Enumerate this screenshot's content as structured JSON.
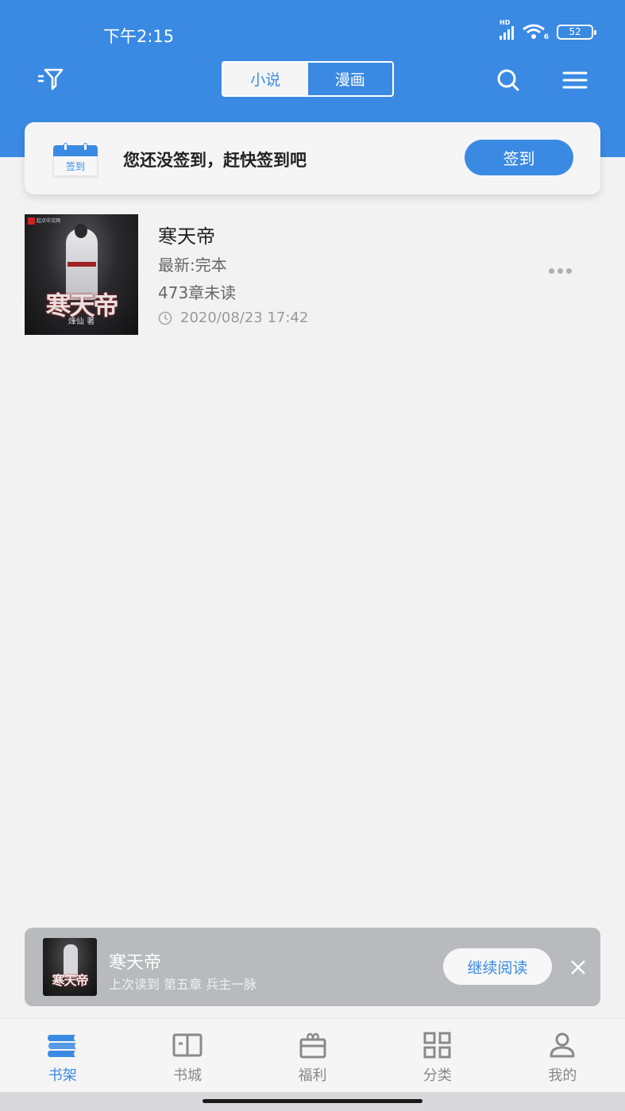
{
  "status_bar": {
    "time": "下午2:15",
    "network_label": "HD",
    "wifi_label": "6",
    "battery": "52"
  },
  "header": {
    "tabs": [
      {
        "label": "小说",
        "active": true
      },
      {
        "label": "漫画",
        "active": false
      }
    ],
    "icons": {
      "left": "filter-icon",
      "search": "search-icon",
      "menu": "menu-icon"
    }
  },
  "signin": {
    "icon_label": "签到",
    "message": "您还没签到，赶快签到吧",
    "button_label": "签到"
  },
  "books": [
    {
      "title": "寒天帝",
      "latest": "最新:完本",
      "unread": "473章未读",
      "updated": "2020/08/23 17:42",
      "cover_title": "寒天帝",
      "cover_author": "烽仙 著",
      "cover_publisher": "起点中文网"
    }
  ],
  "continue_reading": {
    "title": "寒天帝",
    "subtitle": "上次读到 第五章 兵主一脉",
    "button_label": "继续阅读",
    "cover_title": "寒天帝"
  },
  "tabbar": {
    "items": [
      {
        "label": "书架",
        "icon": "bookshelf-icon",
        "active": true
      },
      {
        "label": "书城",
        "icon": "book-open-icon",
        "active": false
      },
      {
        "label": "福利",
        "icon": "gift-icon",
        "active": false
      },
      {
        "label": "分类",
        "icon": "grid-icon",
        "active": false
      },
      {
        "label": "我的",
        "icon": "user-icon",
        "active": false
      }
    ]
  },
  "colors": {
    "accent": "#3a8ae3",
    "background": "#f2f2f2",
    "inactive": "#888888"
  }
}
